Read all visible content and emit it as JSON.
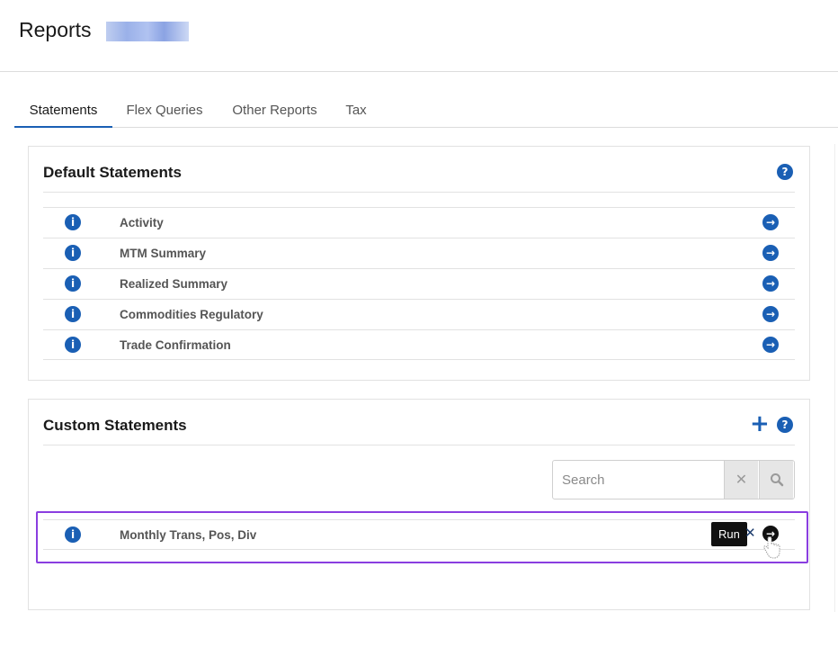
{
  "header": {
    "title": "Reports"
  },
  "tabs": [
    {
      "label": "Statements",
      "active": true
    },
    {
      "label": "Flex Queries",
      "active": false
    },
    {
      "label": "Other Reports",
      "active": false
    },
    {
      "label": "Tax",
      "active": false
    }
  ],
  "default_statements": {
    "title": "Default Statements",
    "items": [
      {
        "label": "Activity"
      },
      {
        "label": "MTM Summary"
      },
      {
        "label": "Realized Summary"
      },
      {
        "label": "Commodities Regulatory"
      },
      {
        "label": "Trade Confirmation"
      }
    ]
  },
  "custom_statements": {
    "title": "Custom Statements",
    "search": {
      "placeholder": "Search",
      "value": ""
    },
    "items": [
      {
        "label": "Monthly Trans, Pos, Div"
      }
    ]
  },
  "tooltip": {
    "text": "Run"
  },
  "icons": {
    "info": "info-circle-icon",
    "run": "arrow-right-circle-icon",
    "help": "question-circle-icon",
    "add": "plus-icon",
    "clear": "x-icon",
    "search": "magnifier-icon",
    "delete": "x-icon"
  },
  "colors": {
    "accent": "#1a5fb4",
    "highlight": "#8a3ee0",
    "tooltip_bg": "#111111"
  }
}
